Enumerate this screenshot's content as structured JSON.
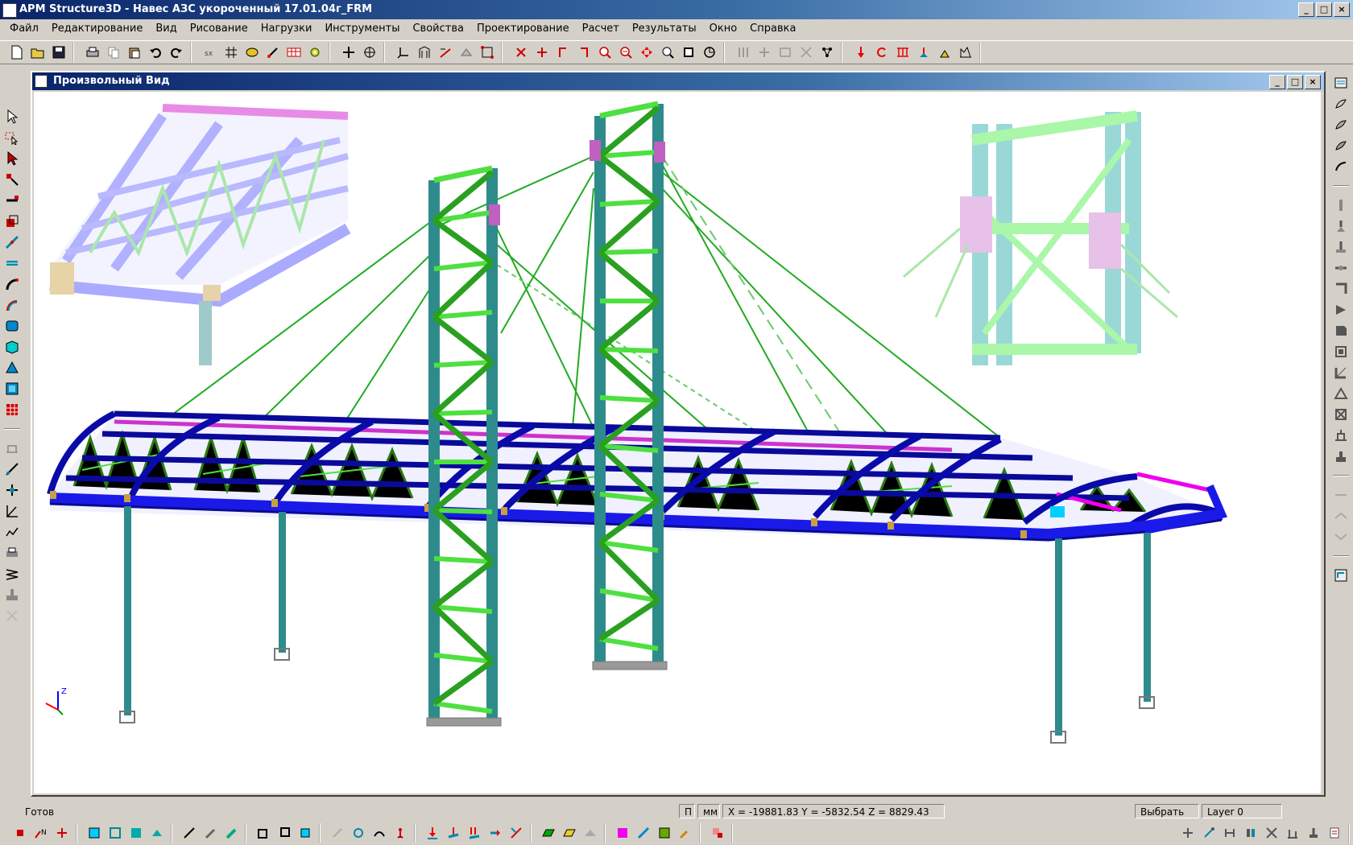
{
  "window": {
    "title": "APM Structure3D - Навес АЗС укороченный 17.01.04г_FRM",
    "buttons": [
      "_",
      "□",
      "×"
    ]
  },
  "menu": [
    "Файл",
    "Редактирование",
    "Вид",
    "Рисование",
    "Нагрузки",
    "Инструменты",
    "Свойства",
    "Проектирование",
    "Расчет",
    "Результаты",
    "Окно",
    "Справка"
  ],
  "document": {
    "title": "Произвольный Вид",
    "buttons": [
      "_",
      "□",
      "×"
    ]
  },
  "viewport": {
    "axes": {
      "z": "Z",
      "x": "X",
      "y": "Y"
    }
  },
  "status": {
    "ready": "Готов",
    "mode_p": "П",
    "units": "мм",
    "coords": "X = -19881.83 Y = -5832.54 Z = 8829.43",
    "action": "Выбрать",
    "layer": "Layer 0"
  },
  "colors": {
    "roof_frame": "#1010b8",
    "roof_beam": "#0000cc",
    "column": "#2e8b8b",
    "bracing": "#44ee22",
    "cable": "#22aa22",
    "ridge": "#cc33cc",
    "title_bar": "#0a246a"
  },
  "toolbar_icons": [
    "new-icon",
    "open-icon",
    "save-icon",
    "print-icon",
    "copy-icon",
    "paste-icon",
    "undo-icon",
    "redo-icon",
    "grid-icon",
    "snap-icon",
    "node-icon",
    "element-icon",
    "zoom-in-icon",
    "zoom-out-icon",
    "pan-icon",
    "rotate-icon",
    "load-icon",
    "support-icon"
  ]
}
